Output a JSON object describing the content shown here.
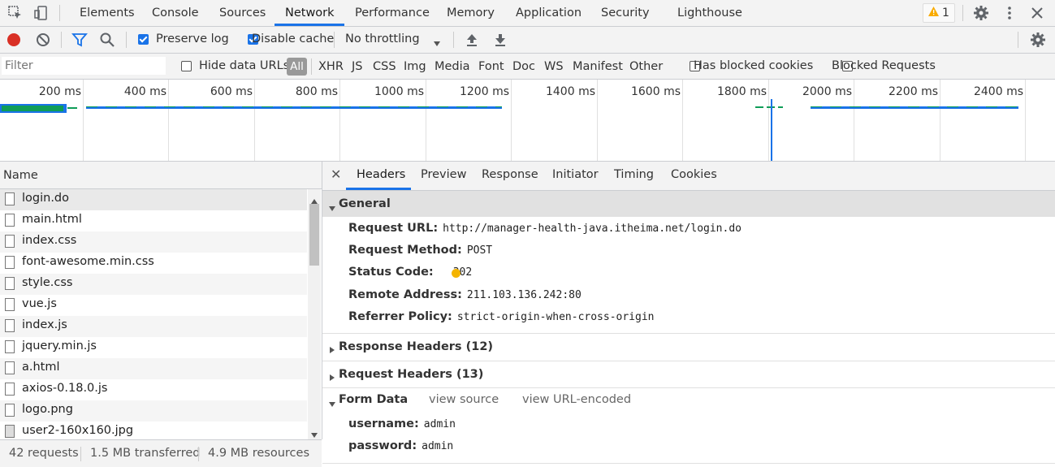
{
  "top_tabs": [
    "Elements",
    "Console",
    "Sources",
    "Network",
    "Performance",
    "Memory",
    "Application",
    "Security",
    "Lighthouse"
  ],
  "warning_count": "1",
  "toolbar": {
    "preserve_log": "Preserve log",
    "disable_cache": "Disable cache",
    "throttling": "No throttling"
  },
  "filter": {
    "placeholder": "Filter",
    "hide_data_urls": "Hide data URLs",
    "all": "All",
    "types": [
      "XHR",
      "JS",
      "CSS",
      "Img",
      "Media",
      "Font",
      "Doc",
      "WS",
      "Manifest",
      "Other"
    ],
    "has_blocked_cookies": "Has blocked cookies",
    "blocked_requests": "Blocked Requests"
  },
  "timeline": {
    "ticks": [
      "200 ms",
      "400 ms",
      "600 ms",
      "800 ms",
      "1000 ms",
      "1200 ms",
      "1400 ms",
      "1600 ms",
      "1800 ms",
      "2000 ms",
      "2200 ms",
      "2400 ms"
    ]
  },
  "name_header": "Name",
  "files": [
    "login.do",
    "main.html",
    "index.css",
    "font-awesome.min.css",
    "style.css",
    "vue.js",
    "index.js",
    "jquery.min.js",
    "a.html",
    "axios-0.18.0.js",
    "logo.png",
    "user2-160x160.jpg"
  ],
  "status": {
    "requests": "42 requests",
    "transferred": "1.5 MB transferred",
    "resources": "4.9 MB resources"
  },
  "detail_tabs": [
    "Headers",
    "Preview",
    "Response",
    "Initiator",
    "Timing",
    "Cookies"
  ],
  "general": {
    "title": "General",
    "request_url_label": "Request URL:",
    "request_url": "http://manager-health-java.itheima.net/login.do",
    "request_method_label": "Request Method:",
    "request_method": "POST",
    "status_code_label": "Status Code:",
    "status_code": "302",
    "remote_address_label": "Remote Address:",
    "remote_address": "211.103.136.242:80",
    "referrer_policy_label": "Referrer Policy:",
    "referrer_policy": "strict-origin-when-cross-origin"
  },
  "response_headers": "Response Headers (12)",
  "request_headers": "Request Headers (13)",
  "form_data": {
    "title": "Form Data",
    "view_source": "view source",
    "view_url_encoded": "view URL-encoded",
    "username_label": "username:",
    "username": "admin",
    "password_label": "password:",
    "password": "admin"
  },
  "colors": {
    "accent": "#1a73e8",
    "record": "#d93025",
    "status_dot": "#f4b400",
    "timeline_green": "#0f9d58"
  }
}
